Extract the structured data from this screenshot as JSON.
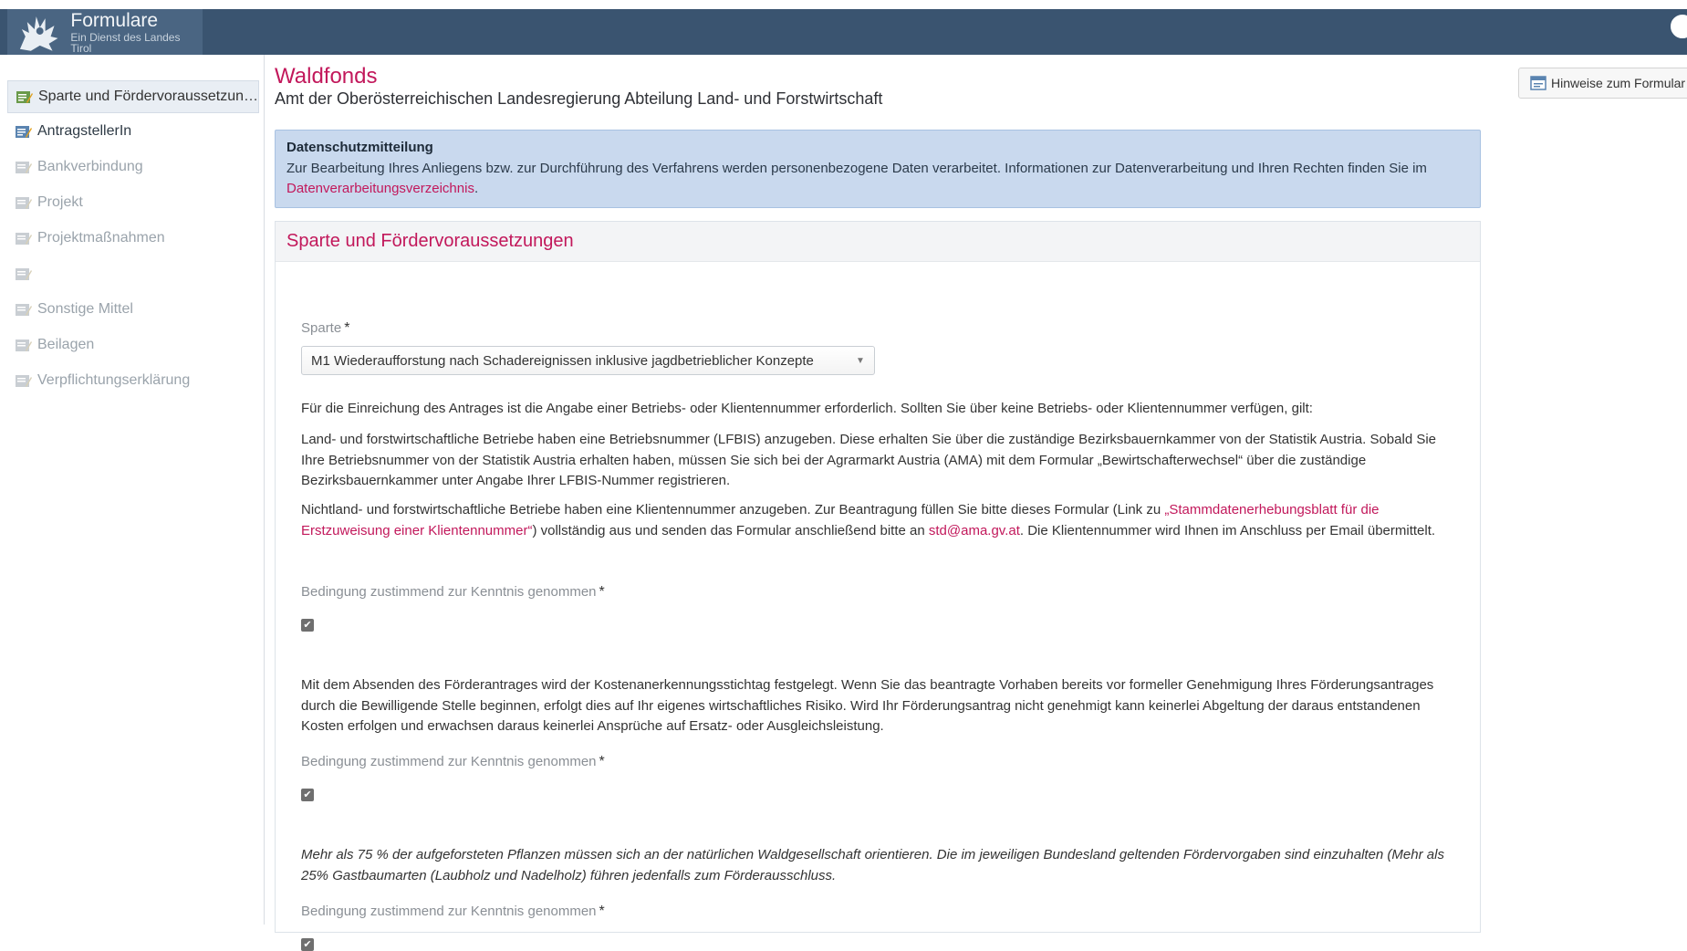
{
  "header": {
    "logo_title": "Formulare",
    "logo_subtitle": "Ein Dienst des Landes Tirol",
    "brand_color": "#3a5470"
  },
  "sidebar": {
    "items": [
      {
        "label": "Sparte und Fördervoraussetzun…",
        "state": "active"
      },
      {
        "label": "AntragstellerIn",
        "state": "done"
      },
      {
        "label": "Bankverbindung",
        "state": "pending"
      },
      {
        "label": "Projekt",
        "state": "pending"
      },
      {
        "label": "Projektmaßnahmen",
        "state": "pending"
      },
      {
        "label": "",
        "state": "pending"
      },
      {
        "label": "Sonstige Mittel",
        "state": "pending"
      },
      {
        "label": "Beilagen",
        "state": "pending"
      },
      {
        "label": "Verpflichtungserklärung",
        "state": "pending"
      }
    ]
  },
  "main": {
    "title": "Waldfonds",
    "subtitle": "Amt der Oberösterreichischen Landesregierung Abteilung Land- und Forstwirtschaft",
    "hint_button": "Hinweise zum Formular",
    "info": {
      "title": "Datenschutzmitteilung",
      "text": "Zur Bearbeitung Ihres Anliegens bzw. zur Durchführung des Verfahrens werden personenbezogene Daten verarbeitet. Informationen zur Datenverarbeitung und Ihren Rechten finden Sie im ",
      "link": "Datenverarbeitungsverzeichnis",
      "text_end": "."
    },
    "section": {
      "title": "Sparte und Fördervoraussetzungen",
      "sparte_label": "Sparte",
      "required_mark": "*",
      "sparte_value": "M1 Wiederaufforstung nach Schadereignissen inklusive jagdbetrieblicher Konzepte",
      "para1": "Für die Einreichung des Antrages ist die Angabe einer Betriebs- oder Klientennummer erforderlich. Sollten Sie über keine Betriebs- oder Klientennummer verfügen, gilt:",
      "para2": "Land- und forstwirtschaftliche Betriebe haben eine Betriebsnummer (LFBIS) anzugeben. Diese erhalten Sie über die zuständige Bezirksbauernkammer von der Statistik Austria. Sobald Sie Ihre Betriebsnummer von der Statistik Austria erhalten haben, müssen Sie sich bei der Agrarmarkt Austria (AMA) mit dem Formular „Bewirtschafterwechsel“ über die zuständige Bezirksbauernkammer unter Angabe Ihrer LFBIS-Nummer registrieren.",
      "para3_a": "Nichtland- und forstwirtschaftliche Betriebe haben eine Klientennummer anzugeben. Zur Beantragung füllen Sie bitte dieses Formular (Link zu ",
      "para3_link": "„Stammdatenerhebungsblatt für die Erstzuweisung einer Klientennummer“",
      "para3_b": ") vollständig aus und senden das Formular anschließend bitte an ",
      "para3_email": "std@ama.gv.at",
      "para3_c": ". Die Klientennummer wird Ihnen im Anschluss per Email übermittelt.",
      "condition_label": "Bedingung zustimmend zur Kenntnis genommen",
      "check_mark": "✔",
      "para4": "Mit dem Absenden des Förderantrages wird der Kostenanerkennungsstichtag festgelegt. Wenn Sie das beantragte Vorhaben bereits vor formeller Genehmigung Ihres Förderungsantrages durch die Bewilligende Stelle beginnen, erfolgt dies auf Ihr eigenes wirtschaftliches Risiko. Wird Ihr Förderungsantrag nicht genehmigt kann keinerlei Abgeltung der daraus entstandenen Kosten erfolgen und erwachsen daraus keinerlei Ansprüche auf Ersatz- oder Ausgleichsleistung.",
      "para5": "Mehr als 75 % der aufgeforsteten Pflanzen müssen sich an der natürlichen Waldgesellschaft orientieren. Die im jeweiligen Bundesland geltenden Fördervorgaben sind einzuhalten (Mehr als 25% Gastbaumarten (Laubholz und Nadelholz) führen jedenfalls zum Förderausschluss."
    }
  }
}
